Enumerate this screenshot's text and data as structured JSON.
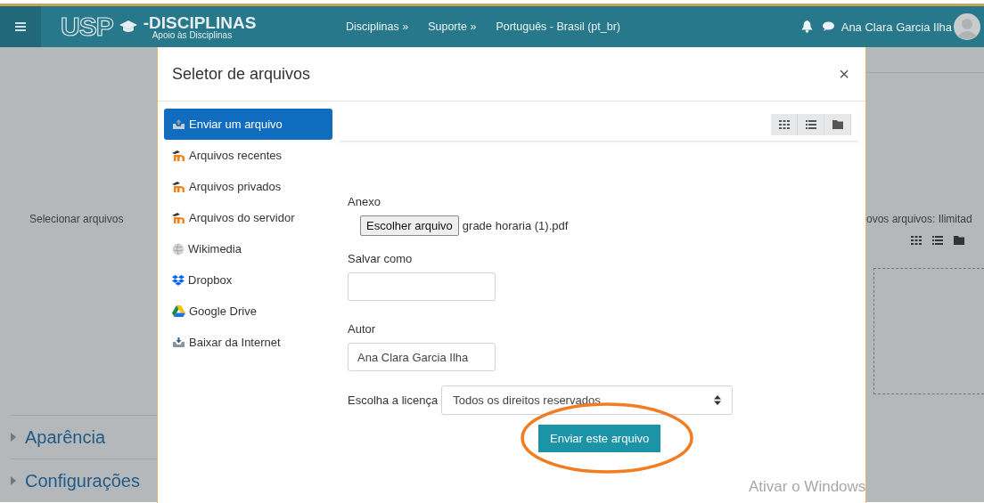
{
  "navbar": {
    "brand_mark": "USP",
    "brand_name": "-DISCIPLINAS",
    "brand_tagline": "Apoio às Disciplinas",
    "menu": [
      "Disciplinas »",
      "Suporte »",
      "Português - Brasil (pt_br)"
    ],
    "user_name": "Ana Clara Garcia Ilha"
  },
  "page": {
    "left_label": "Selecionar arquivos",
    "right_text": "ovos arquivos: Ilimitad",
    "sections": [
      "Aparência",
      "Configurações"
    ]
  },
  "dialog": {
    "title": "Seletor de arquivos",
    "close": "×",
    "repositories": [
      {
        "label": "Enviar um arquivo",
        "kind": "upload",
        "selected": true
      },
      {
        "label": "Arquivos recentes",
        "kind": "moodle",
        "selected": false
      },
      {
        "label": "Arquivos privados",
        "kind": "moodle",
        "selected": false
      },
      {
        "label": "Arquivos do servidor",
        "kind": "moodle",
        "selected": false
      },
      {
        "label": "Wikimedia",
        "kind": "wikimedia",
        "selected": false
      },
      {
        "label": "Dropbox",
        "kind": "dropbox",
        "selected": false
      },
      {
        "label": "Google Drive",
        "kind": "gdrive",
        "selected": false
      },
      {
        "label": "Baixar da Internet",
        "kind": "download",
        "selected": false
      }
    ],
    "attachment_label": "Anexo",
    "choose_button": "Escolher arquivo",
    "file_name": "grade horaria (1).pdf",
    "save_as_label": "Salvar como",
    "author_label": "Autor",
    "author_value": "Ana Clara Garcia Ilha",
    "license_label": "Escolha a licença",
    "license_value": "Todos os direitos reservados",
    "submit": "Enviar este arquivo"
  },
  "os_watermark": "Ativar o Windows"
}
